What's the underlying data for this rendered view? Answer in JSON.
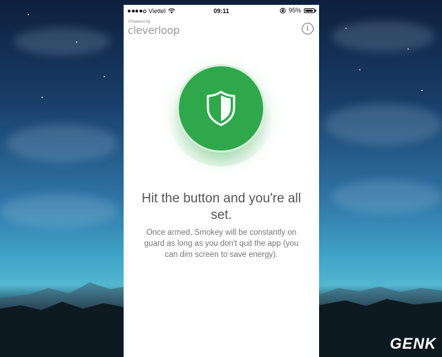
{
  "status_bar": {
    "carrier": "Viettel",
    "time": "09:11",
    "battery_percent": "95%",
    "battery_level": 0.95,
    "signal_bars": 4
  },
  "header": {
    "powered_by": "Powered by",
    "brand": "cleverloop",
    "info_icon": "info-icon"
  },
  "arm_button": {
    "icon": "shield-icon",
    "color": "#2ea84b"
  },
  "main": {
    "headline": "Hit the button and you're all set.",
    "description": "Once armed, Smokey will be constantly on guard as long as you don't quit the app (you can dim screen to save energy)."
  },
  "watermark": "GENK"
}
